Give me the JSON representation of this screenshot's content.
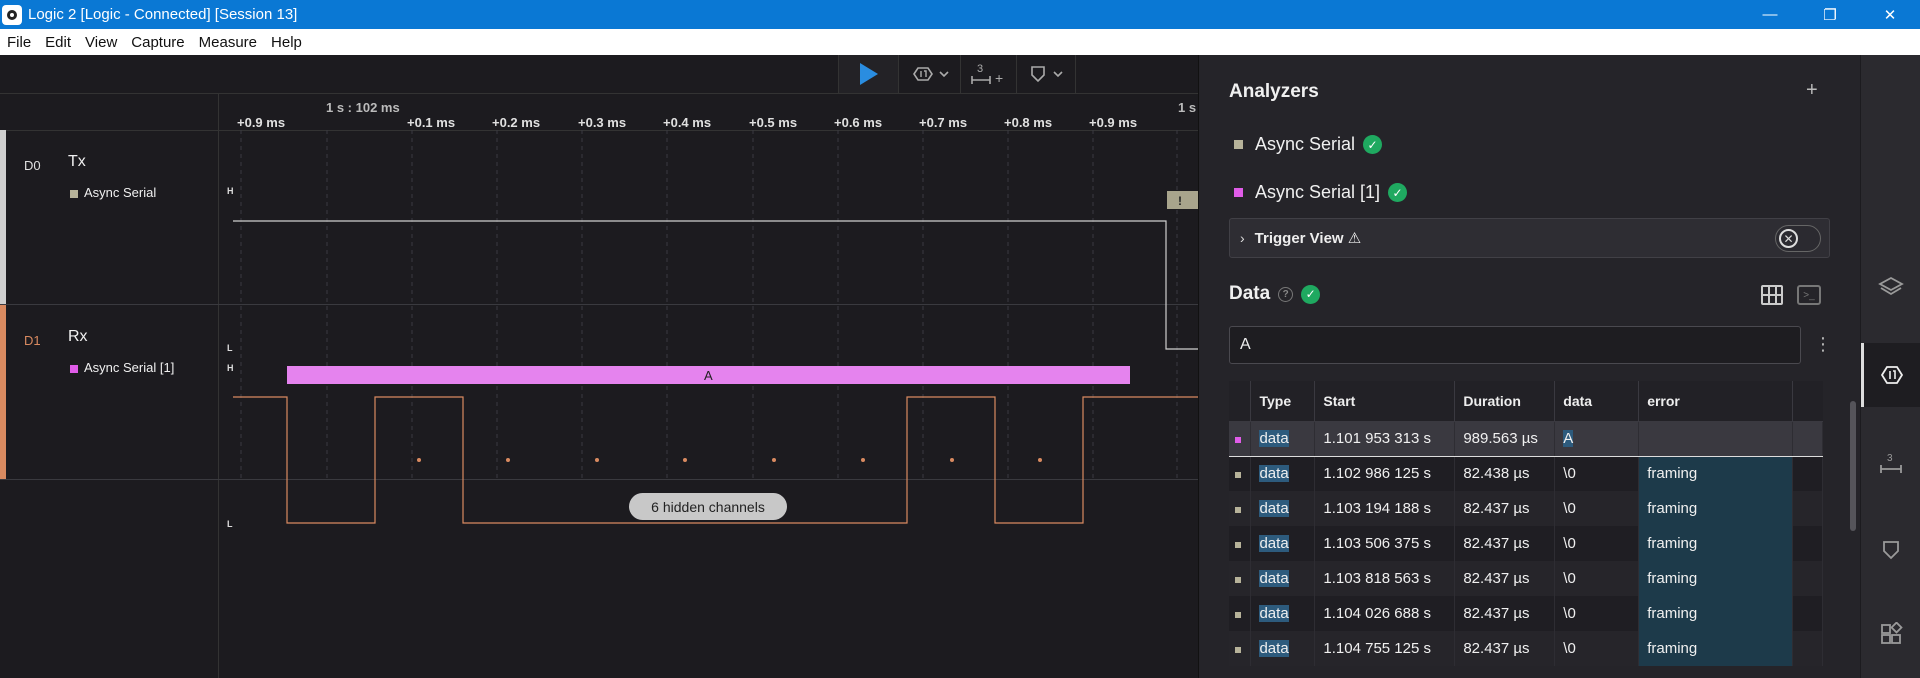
{
  "window": {
    "title": "Logic 2 [Logic - Connected] [Session 13]",
    "minimize": "—",
    "maximize": "❐",
    "close": "✕"
  },
  "menu": [
    "File",
    "Edit",
    "View",
    "Capture",
    "Measure",
    "Help"
  ],
  "toolbar": {
    "measure_label": "3",
    "plus": "+"
  },
  "ruler": {
    "reference": "1 s : 102 ms",
    "ticks": [
      "+0.9 ms",
      "+0.1 ms",
      "+0.2 ms",
      "+0.3 ms",
      "+0.4 ms",
      "+0.5 ms",
      "+0.6 ms",
      "+0.7 ms",
      "+0.8 ms",
      "+0.9 ms",
      "1 s"
    ]
  },
  "channels": [
    {
      "num": "D0",
      "name": "Tx",
      "analyzer": "Async Serial",
      "color": "#cfcfcf",
      "swatch": "#b7b39a"
    },
    {
      "num": "D1",
      "name": "Rx",
      "analyzer": "Async Serial [1]",
      "color": "#d98a60",
      "swatch": "#e05ce8"
    }
  ],
  "wave": {
    "high": "H",
    "low": "L",
    "decoded_frame": "A",
    "warning": "!"
  },
  "hidden_channels": "6 hidden channels",
  "panel": {
    "analyzers_title": "Analyzers",
    "add": "+",
    "analyzers": [
      {
        "name": "Async Serial",
        "color": "#b7b39a"
      },
      {
        "name": "Async Serial [1]",
        "color": "#e05ce8"
      }
    ],
    "trigger_view": "Trigger View ⚠",
    "data_title": "Data",
    "help": "?",
    "search_value": "A",
    "kebab": "⋮",
    "columns": [
      "Type",
      "Start",
      "Duration",
      "data",
      "error"
    ],
    "rows": [
      {
        "swatch": "#e05ce8",
        "type": "data",
        "start": "1.101 953 313 s",
        "duration": "989.563 µs",
        "data": "A",
        "error": "",
        "selected": true
      },
      {
        "swatch": "#b7b39a",
        "type": "data",
        "start": "1.102 986 125 s",
        "duration": "82.438 µs",
        "data": "\\0",
        "error": "framing"
      },
      {
        "swatch": "#b7b39a",
        "type": "data",
        "start": "1.103 194 188 s",
        "duration": "82.437 µs",
        "data": "\\0",
        "error": "framing"
      },
      {
        "swatch": "#b7b39a",
        "type": "data",
        "start": "1.103 506 375 s",
        "duration": "82.437 µs",
        "data": "\\0",
        "error": "framing"
      },
      {
        "swatch": "#b7b39a",
        "type": "data",
        "start": "1.103 818 563 s",
        "duration": "82.437 µs",
        "data": "\\0",
        "error": "framing"
      },
      {
        "swatch": "#b7b39a",
        "type": "data",
        "start": "1.104 026 688 s",
        "duration": "82.437 µs",
        "data": "\\0",
        "error": "framing"
      },
      {
        "swatch": "#b7b39a",
        "type": "data",
        "start": "1.104 755 125 s",
        "duration": "82.437 µs",
        "data": "\\0",
        "error": "framing"
      }
    ]
  },
  "sidebar": [
    "layers-icon",
    "analyzers-icon",
    "timing-markers-icon",
    "notes-icon",
    "extensions-icon"
  ]
}
